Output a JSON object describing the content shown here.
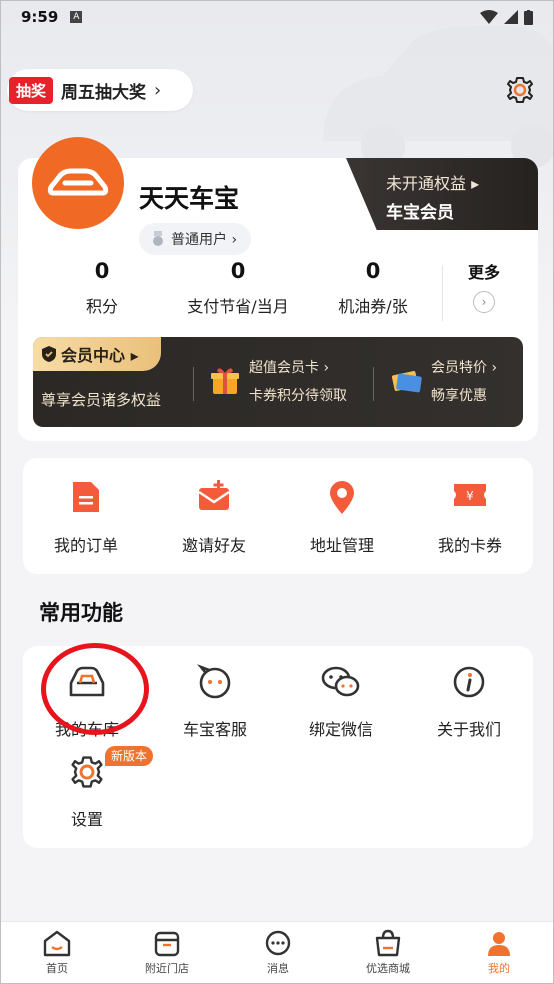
{
  "status_bar": {
    "time": "9:59",
    "notification_badge": "A"
  },
  "top": {
    "lottery_tag": "抽奖",
    "lottery_label": "周五抽大奖",
    "lottery_chevron": "›"
  },
  "profile": {
    "username": "天天车宝",
    "user_type": "普通用户 ›",
    "vip_line1": "未开通权益 ▸",
    "vip_line2": "车宝会员"
  },
  "stats": [
    {
      "value": "0",
      "label": "积分"
    },
    {
      "value": "0",
      "label": "支付节省/当月"
    },
    {
      "value": "0",
      "label": "机油券/张"
    }
  ],
  "more": {
    "label": "更多",
    "icon": "›"
  },
  "member_center": {
    "title": "会员中心 ▸",
    "subtitle": "尊享会员诸多权益",
    "items": [
      {
        "line1": "超值会员卡 ›",
        "line2": "卡券积分待领取",
        "icon": "gift-icon"
      },
      {
        "line1": "会员特价 ›",
        "line2": "畅享优惠",
        "icon": "ticket-icon"
      }
    ]
  },
  "quick_actions": [
    {
      "label": "我的订单",
      "icon": "order-icon"
    },
    {
      "label": "邀请好友",
      "icon": "invite-icon"
    },
    {
      "label": "地址管理",
      "icon": "location-icon"
    },
    {
      "label": "我的卡券",
      "icon": "coupon-icon"
    }
  ],
  "common_functions": {
    "title": "常用功能",
    "items": [
      {
        "label": "我的车库",
        "icon": "car-icon"
      },
      {
        "label": "车宝客服",
        "icon": "service-icon"
      },
      {
        "label": "绑定微信",
        "icon": "wechat-icon"
      },
      {
        "label": "关于我们",
        "icon": "info-icon"
      },
      {
        "label": "设置",
        "icon": "gear-icon"
      }
    ],
    "new_badge": "新版本"
  },
  "tabbar": [
    {
      "label": "首页",
      "icon": "home-icon"
    },
    {
      "label": "附近门店",
      "icon": "store-icon"
    },
    {
      "label": "消息",
      "icon": "message-icon"
    },
    {
      "label": "优选商城",
      "icon": "shop-icon"
    },
    {
      "label": "我的",
      "icon": "profile-icon"
    }
  ],
  "colors": {
    "accent": "#f0722f",
    "red": "#e8222b",
    "dark_card": "#2b2826",
    "gold": "#f2e3cc"
  }
}
